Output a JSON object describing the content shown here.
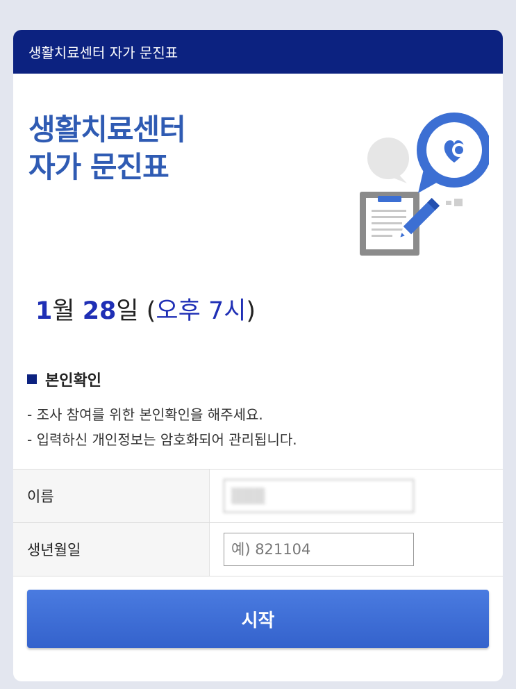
{
  "header": {
    "title": "생활치료센터 자가 문진표"
  },
  "hero": {
    "title_line1": "생활치료센터",
    "title_line2": "자가 문진표"
  },
  "schedule": {
    "month": "1",
    "month_unit": "월",
    "day": "28",
    "day_unit": "일",
    "open_paren": "(",
    "time": "오후 7시",
    "close_paren": ")"
  },
  "identity": {
    "section_title": "본인확인",
    "notices": [
      "- 조사 참여를 위한 본인확인을 해주세요.",
      "- 입력하신 개인정보는 암호화되어 관리됩니다."
    ]
  },
  "form": {
    "name_label": "이름",
    "name_value": "▒▒▒",
    "birth_label": "생년월일",
    "birth_placeholder": "예) 821104"
  },
  "start_button": "시작",
  "colors": {
    "header_bg": "#0c2280",
    "hero_title": "#2f5bb3",
    "date_accent": "#1f2fb5",
    "button": "#3d6fd8"
  }
}
